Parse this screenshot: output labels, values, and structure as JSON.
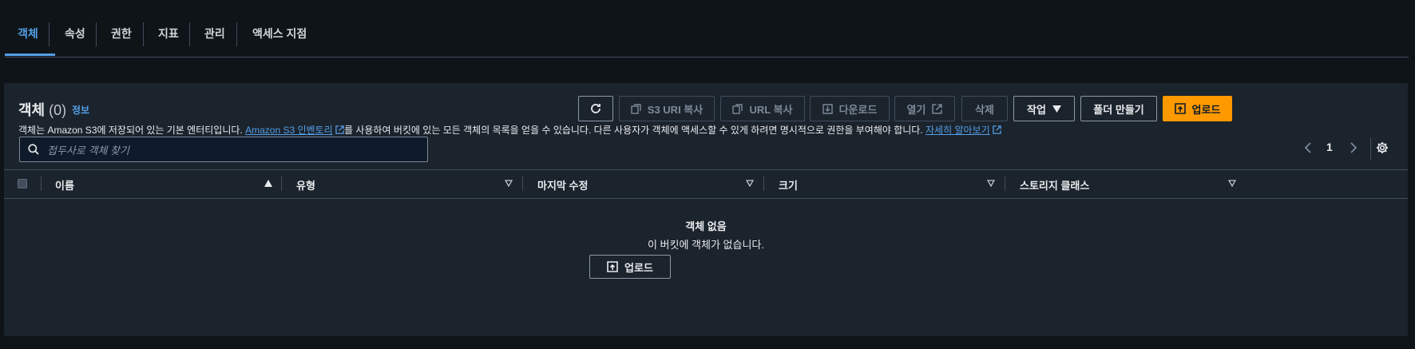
{
  "tabs": [
    "객체",
    "속성",
    "권한",
    "지표",
    "관리",
    "액세스 지점"
  ],
  "panel": {
    "title": "객체",
    "count": "(0)",
    "info": "정보",
    "desc_before": "객체는 Amazon S3에 저장되어 있는 기본 엔터티입니다. ",
    "desc_link1": "Amazon S3 인벤토리",
    "desc_middle": "를 사용하여 버킷에 있는 모든 객체의 목록을 얻을 수 있습니다. 다른 사용자가 객체에 액세스할 수 있게 하려면 명시적으로 권한을 부여해야 합니다. ",
    "desc_link2": "자세히 알아보기"
  },
  "toolbar": {
    "refresh_icon": "refresh-icon",
    "copy_s3_uri": "S3 URI 복사",
    "copy_url": "URL 복사",
    "download": "다운로드",
    "open": "열기",
    "delete": "삭제",
    "actions": "작업",
    "create_folder": "폴더 만들기",
    "upload": "업로드"
  },
  "search": {
    "placeholder": "접두사로 객체 찾기"
  },
  "pagination": {
    "page": "1"
  },
  "table": {
    "columns": [
      "이름",
      "유형",
      "마지막 수정",
      "크기",
      "스토리지 클래스"
    ]
  },
  "empty": {
    "title": "객체 없음",
    "subtitle": "이 버킷에 객체가 없습니다.",
    "upload": "업로드"
  },
  "colors": {
    "accent": "#539fe5",
    "primary": "#ff9900",
    "panel": "#1b232d",
    "background": "#0f1419"
  }
}
